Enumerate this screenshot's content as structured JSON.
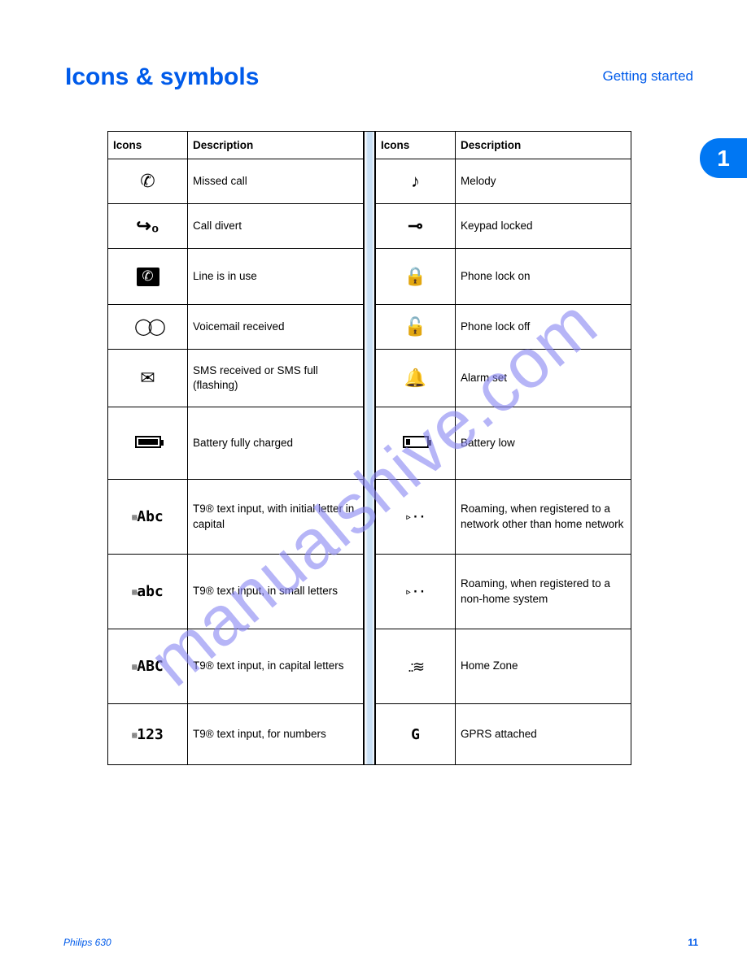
{
  "page": {
    "title": "Icons & symbols",
    "breadcrumb": "Getting started",
    "section_number": "1",
    "page_number": "11",
    "footer_left": "Philips 630",
    "watermark": "manualshive.com"
  },
  "headers": {
    "icon": "Icons",
    "desc": "Description"
  },
  "left_rows": [
    {
      "icon_name": "missed-call-icon",
      "glyph": "✆",
      "label": "Missed call"
    },
    {
      "icon_name": "call-divert-icon",
      "glyph": "↪",
      "label": "Call divert"
    },
    {
      "icon_name": "line-in-use-icon",
      "glyph": "phone-inv",
      "label": "Line is in use"
    },
    {
      "icon_name": "voicemail-icon",
      "glyph": "◯◯",
      "label": "Voicemail received"
    },
    {
      "icon_name": "sms-icon",
      "glyph": "✉",
      "label": "SMS received or SMS full (flashing)"
    },
    {
      "icon_name": "battery-full-icon",
      "glyph": "batt-full",
      "label": "Battery fully charged"
    },
    {
      "icon_name": "t9-initial-cap-icon",
      "glyph": "t9-Abc",
      "label": "T9® text input, with initial letter in capital"
    },
    {
      "icon_name": "t9-lowercase-icon",
      "glyph": "t9-abc",
      "label": "T9® text input, in small letters"
    },
    {
      "icon_name": "t9-uppercase-icon",
      "glyph": "t9-ABC",
      "label": "T9® text input, in capital letters"
    },
    {
      "icon_name": "t9-numeric-icon",
      "glyph": "t9-123",
      "label": "T9® text input, for numbers"
    }
  ],
  "right_rows": [
    {
      "icon_name": "melody-icon",
      "glyph": "♫",
      "label": "Melody"
    },
    {
      "icon_name": "keypad-locked-icon",
      "glyph": "⊸",
      "label": "Keypad locked"
    },
    {
      "icon_name": "phone-lock-on-icon",
      "glyph": "🔒",
      "label": "Phone lock on"
    },
    {
      "icon_name": "phone-lock-off-icon",
      "glyph": "🔓",
      "label": "Phone lock off"
    },
    {
      "icon_name": "alarm-set-icon",
      "glyph": "🔔",
      "label": "Alarm set"
    },
    {
      "icon_name": "battery-low-icon",
      "glyph": "batt-low",
      "label": "Battery low"
    },
    {
      "icon_name": "roaming-home-icon",
      "glyph": "▹··",
      "label": "Roaming, when registered to a network other than home network"
    },
    {
      "icon_name": "roaming-non-home-icon",
      "glyph": "▹··",
      "label": "Roaming, when registered to a non-home system"
    },
    {
      "icon_name": "home-zone-icon",
      "glyph": "≋",
      "label": "Home Zone"
    },
    {
      "icon_name": "gprs-icon",
      "glyph": "G",
      "label": "GPRS attached"
    }
  ]
}
